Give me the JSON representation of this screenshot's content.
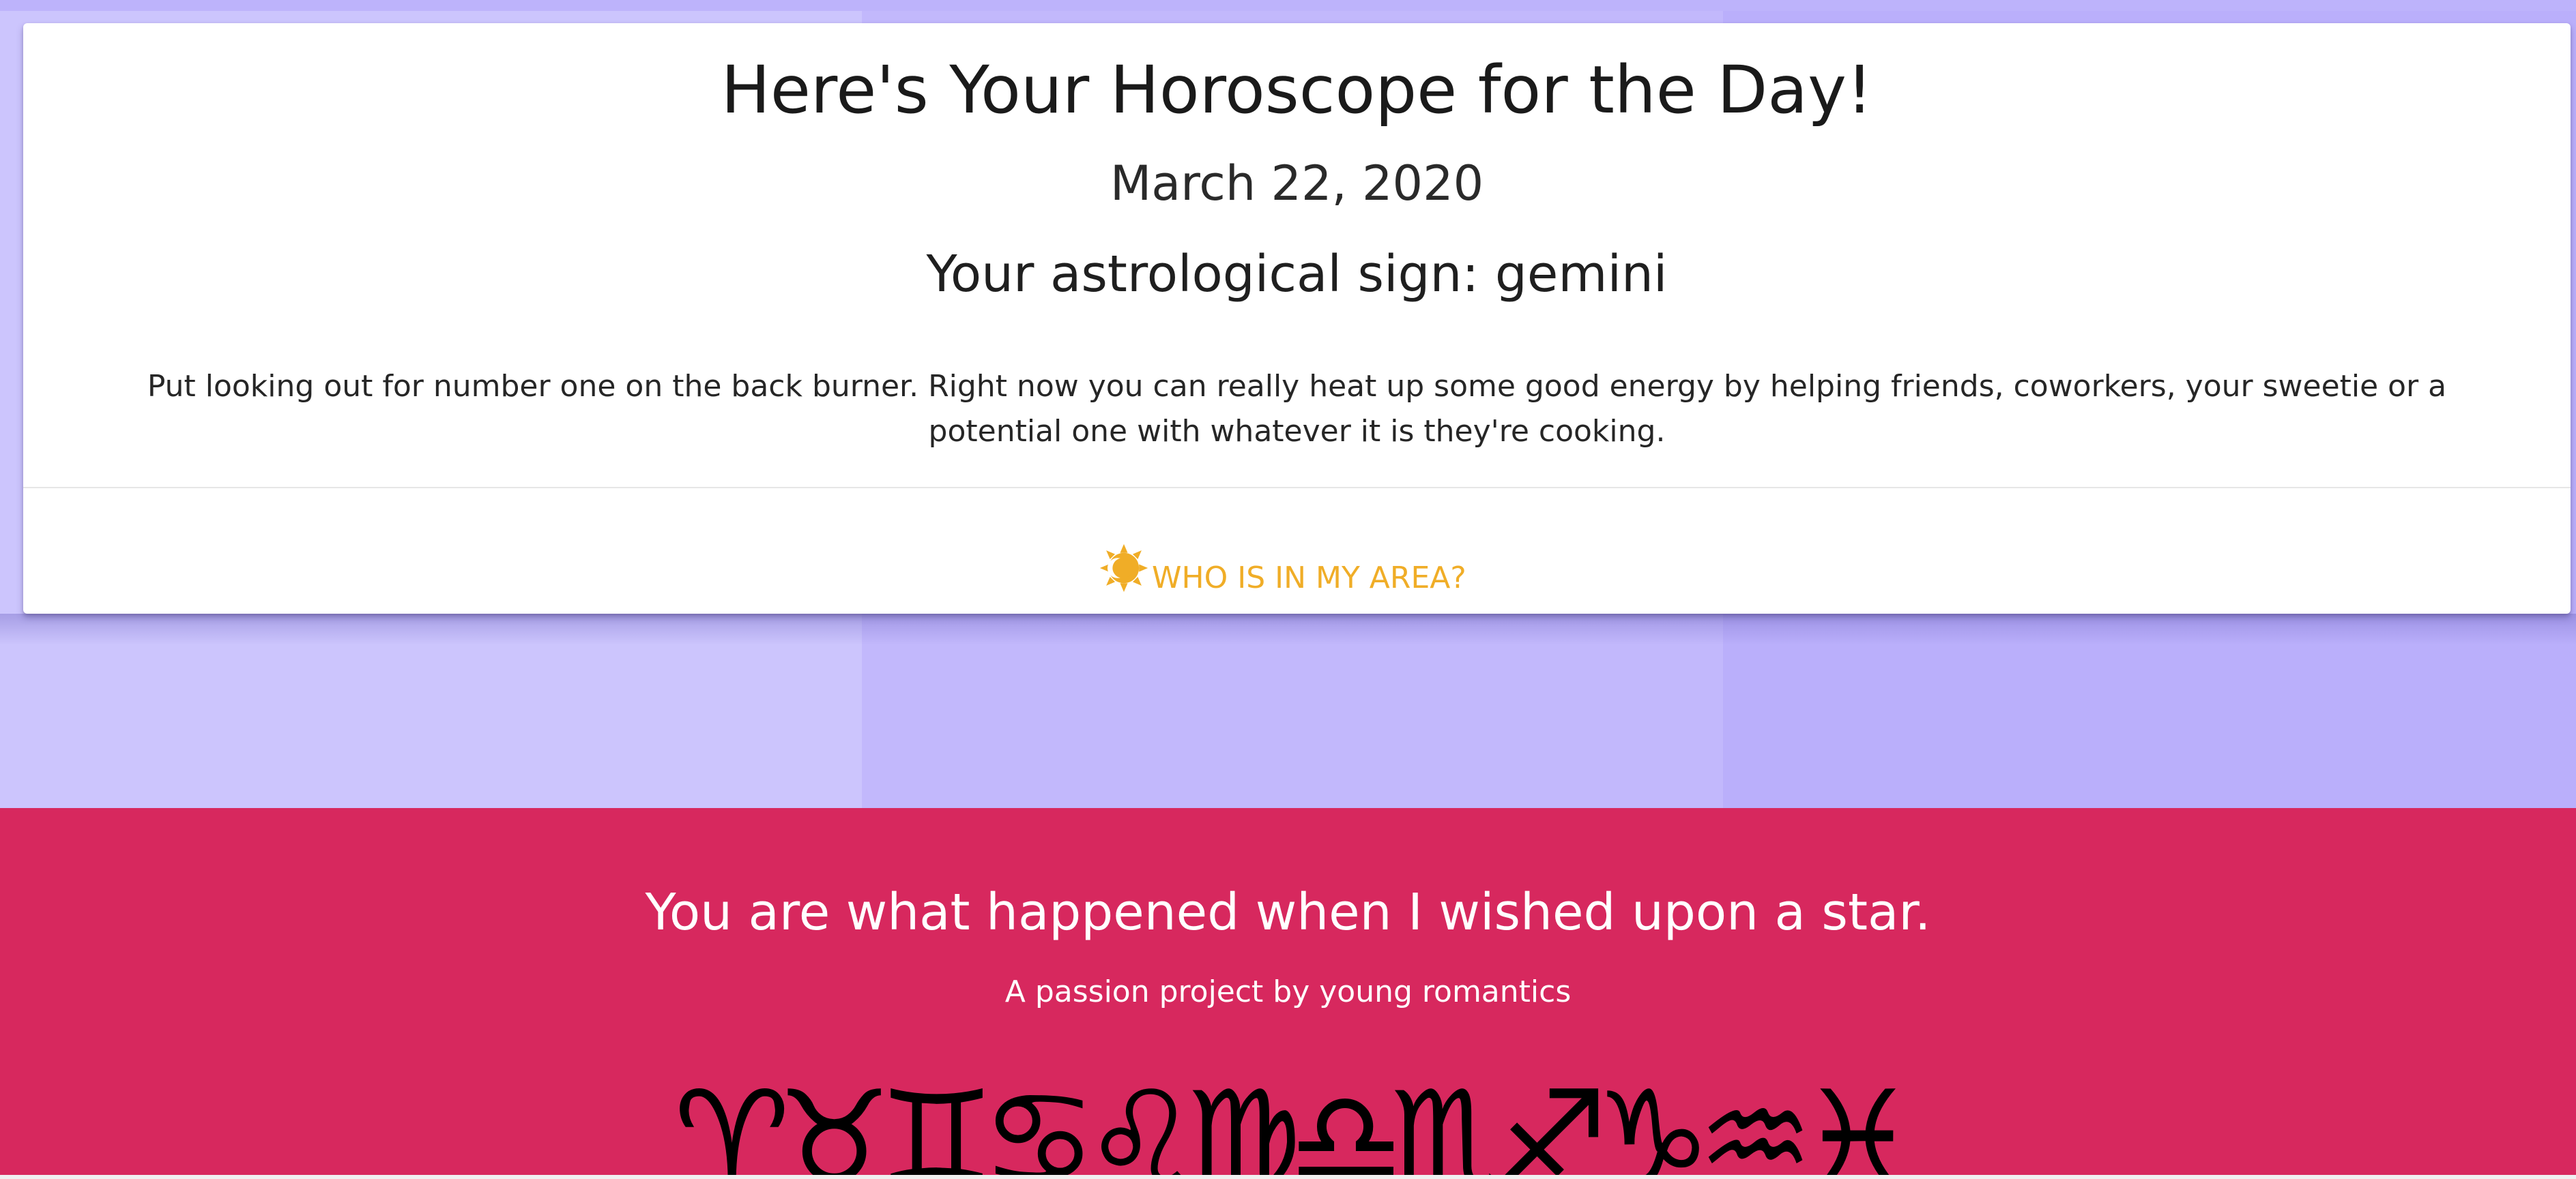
{
  "card": {
    "title": "Here's Your Horoscope for the Day!",
    "date": "March 22, 2020",
    "sign_line": "Your astrological sign: gemini",
    "horoscope": "Put looking out for number one on the back burner. Right now you can really heat up some good energy by helping friends, coworkers, your sweetie or a potential one with whatever it is they're cooking.",
    "area_button": {
      "label": "WHO IS IN MY AREA?",
      "icon": "sun-moon-icon"
    }
  },
  "footer": {
    "quote": "You are what happened when I wished upon a star.",
    "credit": "A passion project by young romantics",
    "zodiac_symbols": [
      {
        "name": "aries",
        "glyph": "♈"
      },
      {
        "name": "taurus",
        "glyph": "♉"
      },
      {
        "name": "gemini",
        "glyph": "♊"
      },
      {
        "name": "cancer",
        "glyph": "♋"
      },
      {
        "name": "leo",
        "glyph": "♌"
      },
      {
        "name": "virgo",
        "glyph": "♍"
      },
      {
        "name": "libra",
        "glyph": "♎"
      },
      {
        "name": "scorpio",
        "glyph": "♏"
      },
      {
        "name": "sagittarius",
        "glyph": "♐"
      },
      {
        "name": "capricorn",
        "glyph": "♑"
      },
      {
        "name": "aquarius",
        "glyph": "♒"
      },
      {
        "name": "pisces",
        "glyph": "♓"
      }
    ]
  },
  "colors": {
    "accent": "#f0ad27",
    "footer_bg": "#d7285e",
    "purple_light": "#ccc5fd",
    "purple_mid": "#c2b8fc",
    "purple_dark": "#baaffb"
  }
}
